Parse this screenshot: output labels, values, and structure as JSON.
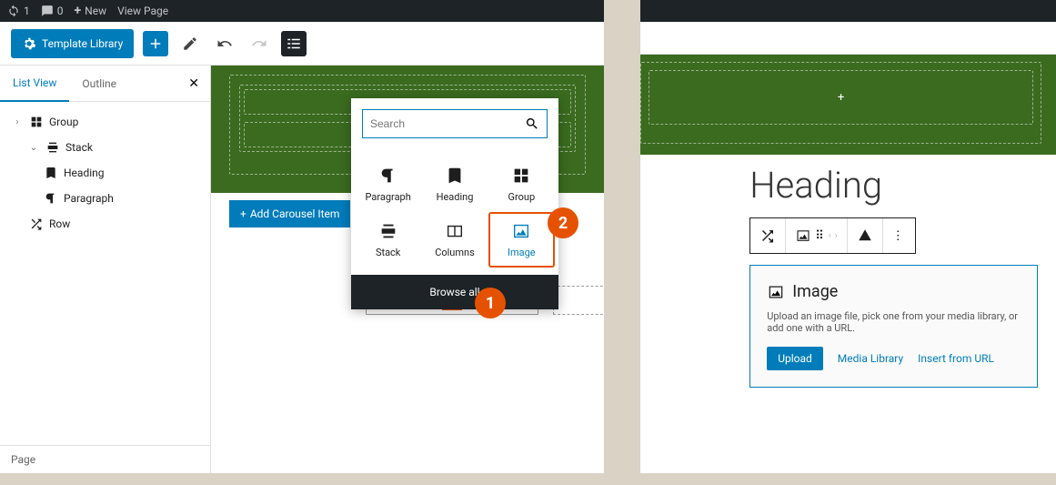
{
  "adminbar": {
    "updates": "1",
    "comments": "0",
    "new": "New",
    "view": "View Page"
  },
  "toolbar": {
    "template_library": "Template Library"
  },
  "sidebar": {
    "tabs": {
      "list_view": "List View",
      "outline": "Outline"
    },
    "tree": {
      "group": "Group",
      "stack": "Stack",
      "heading": "Heading",
      "paragraph": "Paragraph",
      "row": "Row"
    },
    "footer": "Page"
  },
  "carousel_btn": "Add Carousel Item",
  "inserter": {
    "search_placeholder": "Search",
    "blocks": {
      "paragraph": "Paragraph",
      "heading": "Heading",
      "group": "Group",
      "stack": "Stack",
      "columns": "Columns",
      "image": "Image"
    },
    "browse_all": "Browse all"
  },
  "callouts": {
    "one": "1",
    "two": "2"
  },
  "right": {
    "heading": "Heading",
    "image_block": {
      "title": "Image",
      "desc": "Upload an image file, pick one from your media library, or add one with a URL.",
      "upload": "Upload",
      "media": "Media Library",
      "url": "Insert from URL"
    }
  }
}
